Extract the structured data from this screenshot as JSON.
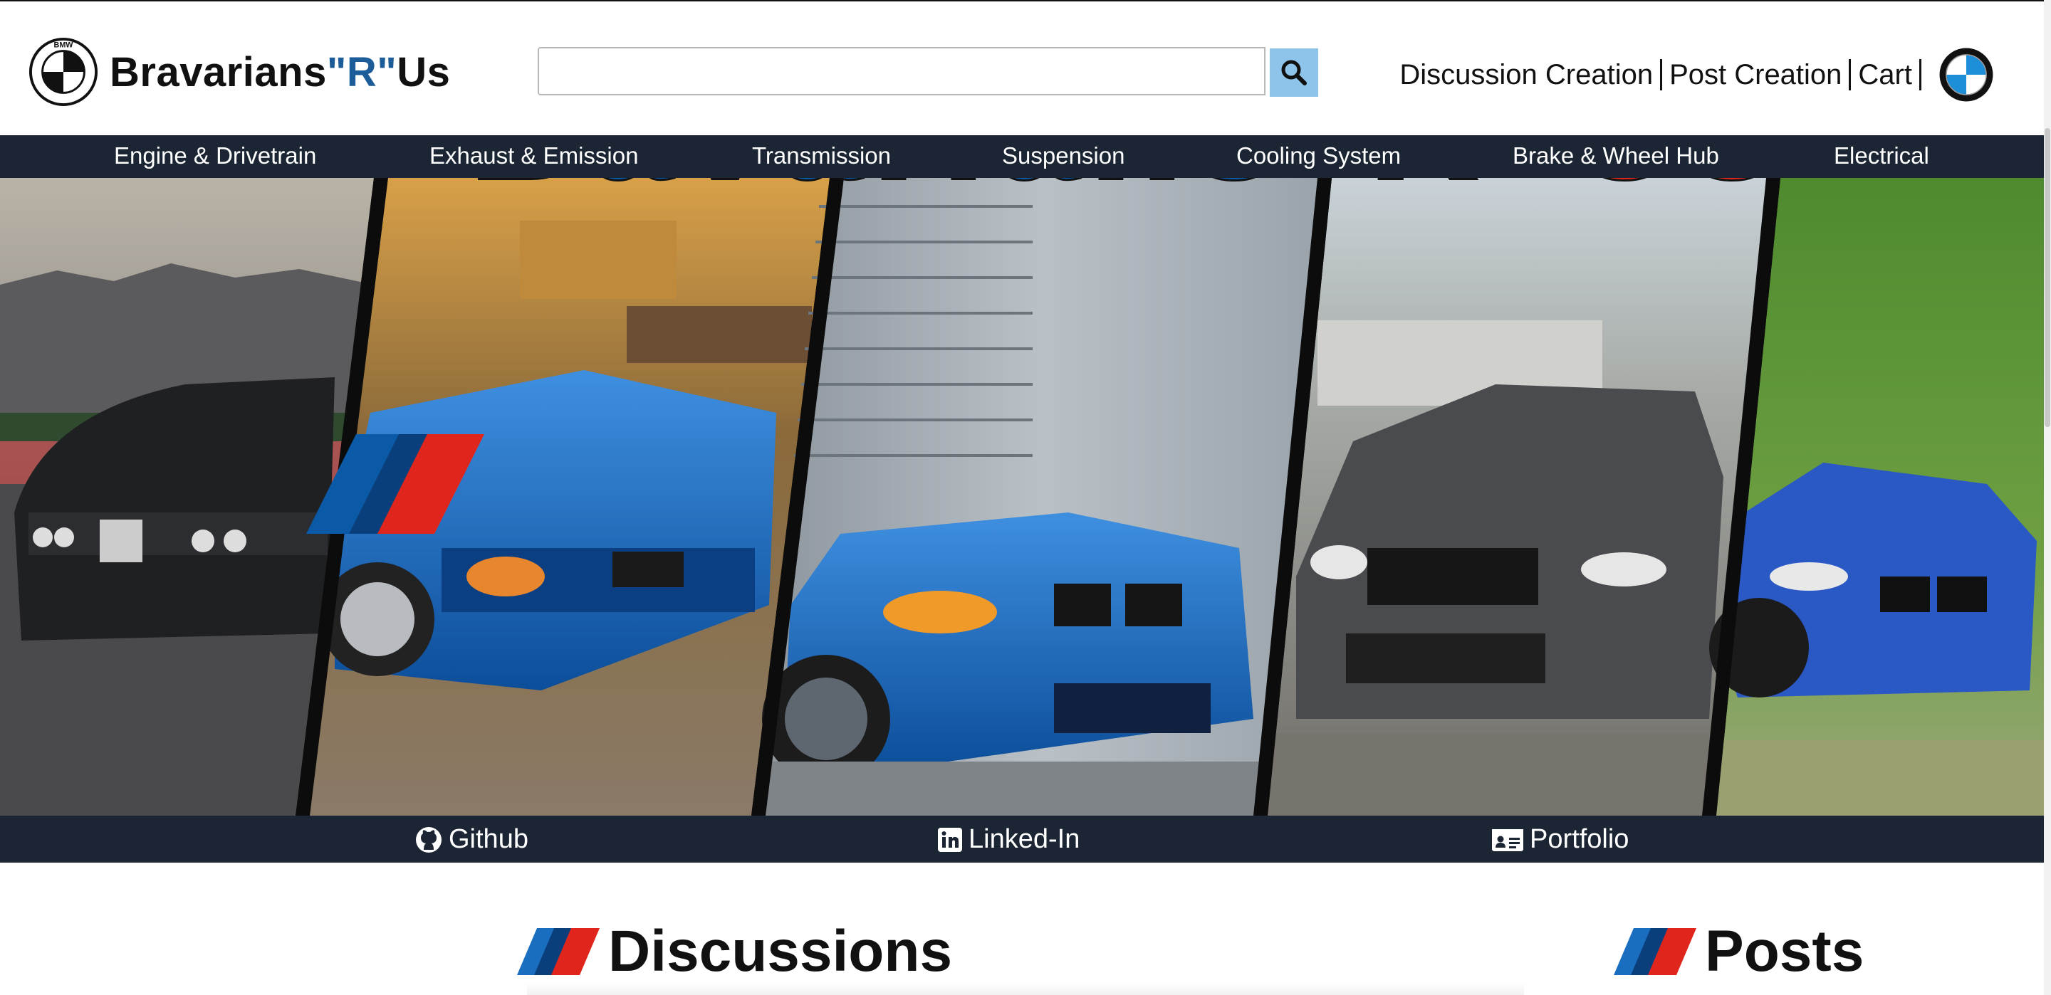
{
  "brand": {
    "name_part1": "Bravarians",
    "name_part2": "\"R\"",
    "name_part3": "Us",
    "logo_letters": "BMW"
  },
  "search": {
    "value": "",
    "placeholder": "",
    "icon": "search-icon"
  },
  "toplinks": [
    {
      "label": "Discussion Creation"
    },
    {
      "label": "Post Creation"
    },
    {
      "label": "Cart"
    }
  ],
  "categories": [
    {
      "label": "Engine & Drivetrain"
    },
    {
      "label": "Exhaust & Emission"
    },
    {
      "label": "Transmission"
    },
    {
      "label": "Suspension"
    },
    {
      "label": "Cooling System"
    },
    {
      "label": "Brake & Wheel Hub"
    },
    {
      "label": "Electrical"
    }
  ],
  "hero": {
    "part1": "Bavarians",
    "part2": "\"R\"",
    "part3": "Us",
    "colors": {
      "blue": "#0a5aa8",
      "dark_blue": "#0b3f7c",
      "red": "#e0261c"
    },
    "image_descriptions": [
      "black BMW E30 M3",
      "blue BMW E36 M3",
      "blue BMW E46 M3",
      "grey BMW E92 M3",
      "blue BMW 2 series"
    ]
  },
  "social": [
    {
      "label": "Github",
      "icon": "github-icon"
    },
    {
      "label": "Linked-In",
      "icon": "linkedin-icon"
    },
    {
      "label": "Portfolio",
      "icon": "id-card-icon"
    }
  ],
  "sections": {
    "discussions": "Discussions",
    "posts": "Posts"
  },
  "colors": {
    "nav_bg": "#1b2533",
    "brand_blue": "#1c5d99",
    "search_button": "#8ec4ea"
  }
}
